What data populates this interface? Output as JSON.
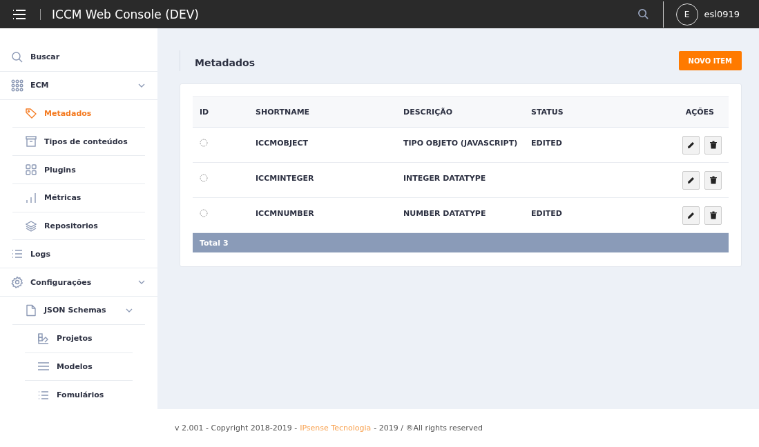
{
  "header": {
    "title": "ICCM Web Console (DEV)",
    "avatar_initial": "E",
    "username": "esl0919"
  },
  "sidebar": {
    "items": [
      {
        "kind": "search",
        "label": "Buscar",
        "selected": false
      },
      {
        "kind": "grid",
        "label": "ECM",
        "selected": false,
        "expanded": true,
        "children": [
          {
            "kind": "tag",
            "label": "Metadados",
            "selected": true
          },
          {
            "kind": "archive",
            "label": "Tipos de conteúdos",
            "selected": false
          },
          {
            "kind": "squares",
            "label": "Plugins",
            "selected": false
          },
          {
            "kind": "bars",
            "label": "Métricas",
            "selected": false
          },
          {
            "kind": "layers",
            "label": "Repositorios",
            "selected": false
          }
        ]
      },
      {
        "kind": "list",
        "label": "Logs",
        "selected": false
      },
      {
        "kind": "gear",
        "label": "Configurações",
        "selected": false,
        "expanded": true,
        "children": [
          {
            "kind": "file",
            "label": "JSON Schemas",
            "selected": false,
            "expanded": true,
            "children": [
              {
                "kind": "chart",
                "label": "Projetos",
                "selected": false
              },
              {
                "kind": "lines",
                "label": "Modelos",
                "selected": false
              },
              {
                "kind": "list",
                "label": "Fomulários",
                "selected": false
              }
            ]
          }
        ]
      }
    ]
  },
  "page": {
    "title": "Metadados",
    "new_button": "NOVO ITEM"
  },
  "table": {
    "columns": [
      "ID",
      "SHORTNAME",
      "DESCRIÇÃO",
      "STATUS",
      "AÇÕES"
    ],
    "rows": [
      {
        "shortname": "ICCMOBJECT",
        "description": "TIPO OBJETO (JAVASCRIPT)",
        "status": "EDITED"
      },
      {
        "shortname": "ICCMINTEGER",
        "description": "INTEGER DATATYPE"
      },
      {
        "shortname": "ICCMNUMBER",
        "description": "NUMBER DATATYPE",
        "status": "EDITED"
      }
    ],
    "total": "Total 3"
  },
  "footer": {
    "before": "v 2.001 - Copyright 2018-2019 -",
    "link": "IPsense Tecnologia",
    "after": "- 2019 / ®All rights reserved"
  }
}
